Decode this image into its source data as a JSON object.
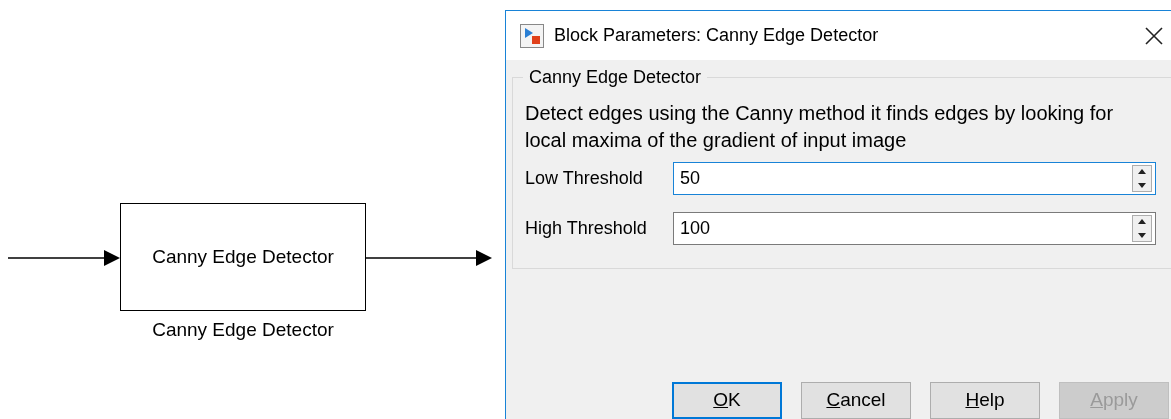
{
  "diagram": {
    "block": {
      "text": "Canny Edge Detector",
      "label": "Canny Edge Detector"
    }
  },
  "window": {
    "title": "Block Parameters: Canny Edge Detector"
  },
  "group": {
    "title": "Canny Edge Detector",
    "description": "Detect edges using the Canny method it finds edges by looking for local maxima of the gradient of input image",
    "fields": [
      {
        "label": "Low Threshold",
        "value": "50",
        "focused": true
      },
      {
        "label": "High Threshold",
        "value": "100",
        "focused": false
      }
    ]
  },
  "buttons": [
    {
      "label": "OK",
      "focused": true,
      "disabled": false
    },
    {
      "label": "Cancel",
      "focused": false,
      "disabled": false
    },
    {
      "label": "Help",
      "focused": false,
      "disabled": false
    },
    {
      "label": "Apply",
      "focused": false,
      "disabled": true
    }
  ]
}
